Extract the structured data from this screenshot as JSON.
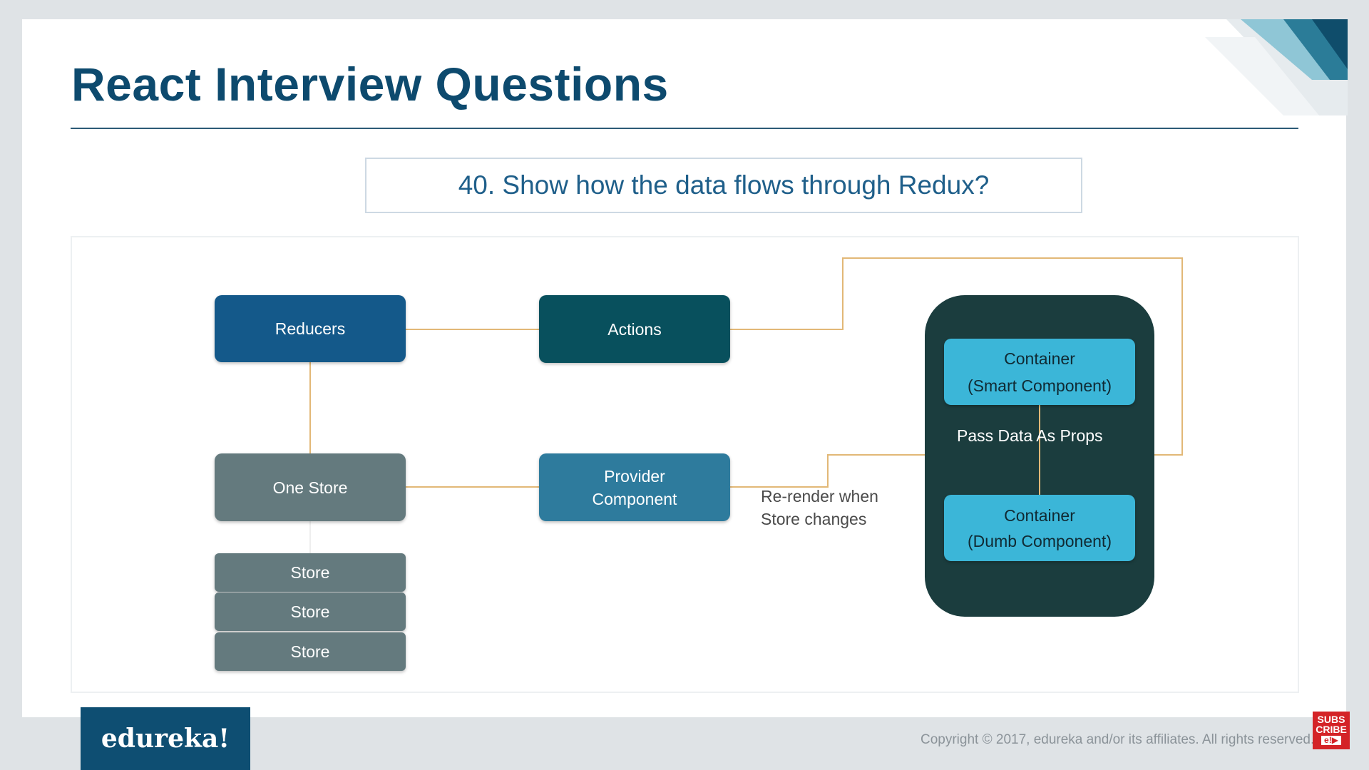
{
  "slide": {
    "title": "React Interview Questions",
    "question": "40. Show how the data flows through Redux?"
  },
  "diagram": {
    "nodes": {
      "reducers": "Reducers",
      "actions": "Actions",
      "one_store": "One Store",
      "provider_line1": "Provider",
      "provider_line2": "Component",
      "stores": [
        "Store",
        "Store",
        "Store"
      ],
      "smart_line1": "Container",
      "smart_line2": "(Smart Component)",
      "dumb_line1": "Container",
      "dumb_line2": "(Dumb Component)"
    },
    "labels": {
      "pass_data": "Pass Data As Props",
      "rerender_line1": "Re-render when",
      "rerender_line2": "Store changes"
    },
    "connector_color": "#e2b877",
    "colors": {
      "reducers": "#14598a",
      "actions": "#08505d",
      "store": "#647a7e",
      "provider": "#2e7b9d",
      "container_group": "#1b3d3e",
      "container": "#3bb6d8",
      "title": "#0d4a6e"
    }
  },
  "footer": {
    "logo": "edureka!",
    "copyright": "Copyright © 2017, edureka and/or its affiliates. All rights reserved.",
    "subscribe_line1": "SUBS",
    "subscribe_line2": "CRIBE",
    "subscribe_tag": "e!▶"
  }
}
